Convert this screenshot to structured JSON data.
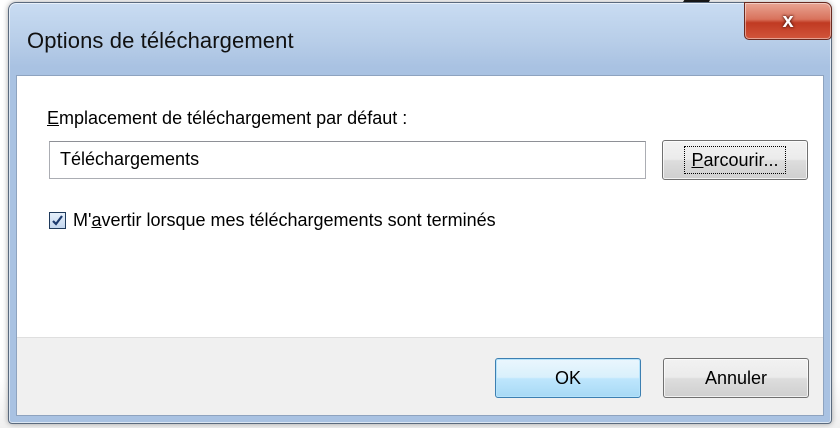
{
  "window": {
    "title": "Options de téléchargement",
    "close_glyph": "x"
  },
  "location": {
    "label_accel": "E",
    "label_rest": "mplacement de téléchargement par défaut :",
    "value": "Téléchargements",
    "browse_accel": "P",
    "browse_rest": "arcourir..."
  },
  "notify": {
    "checked": true,
    "label_pre": "M'",
    "label_accel": "a",
    "label_rest": "vertir lorsque mes téléchargements sont terminés"
  },
  "footer": {
    "ok_label": "OK",
    "cancel_label": "Annuler"
  },
  "colors": {
    "close_button": "#c03a22",
    "titlebar": "#b7cde8",
    "ok_border": "#3c7fb1"
  }
}
